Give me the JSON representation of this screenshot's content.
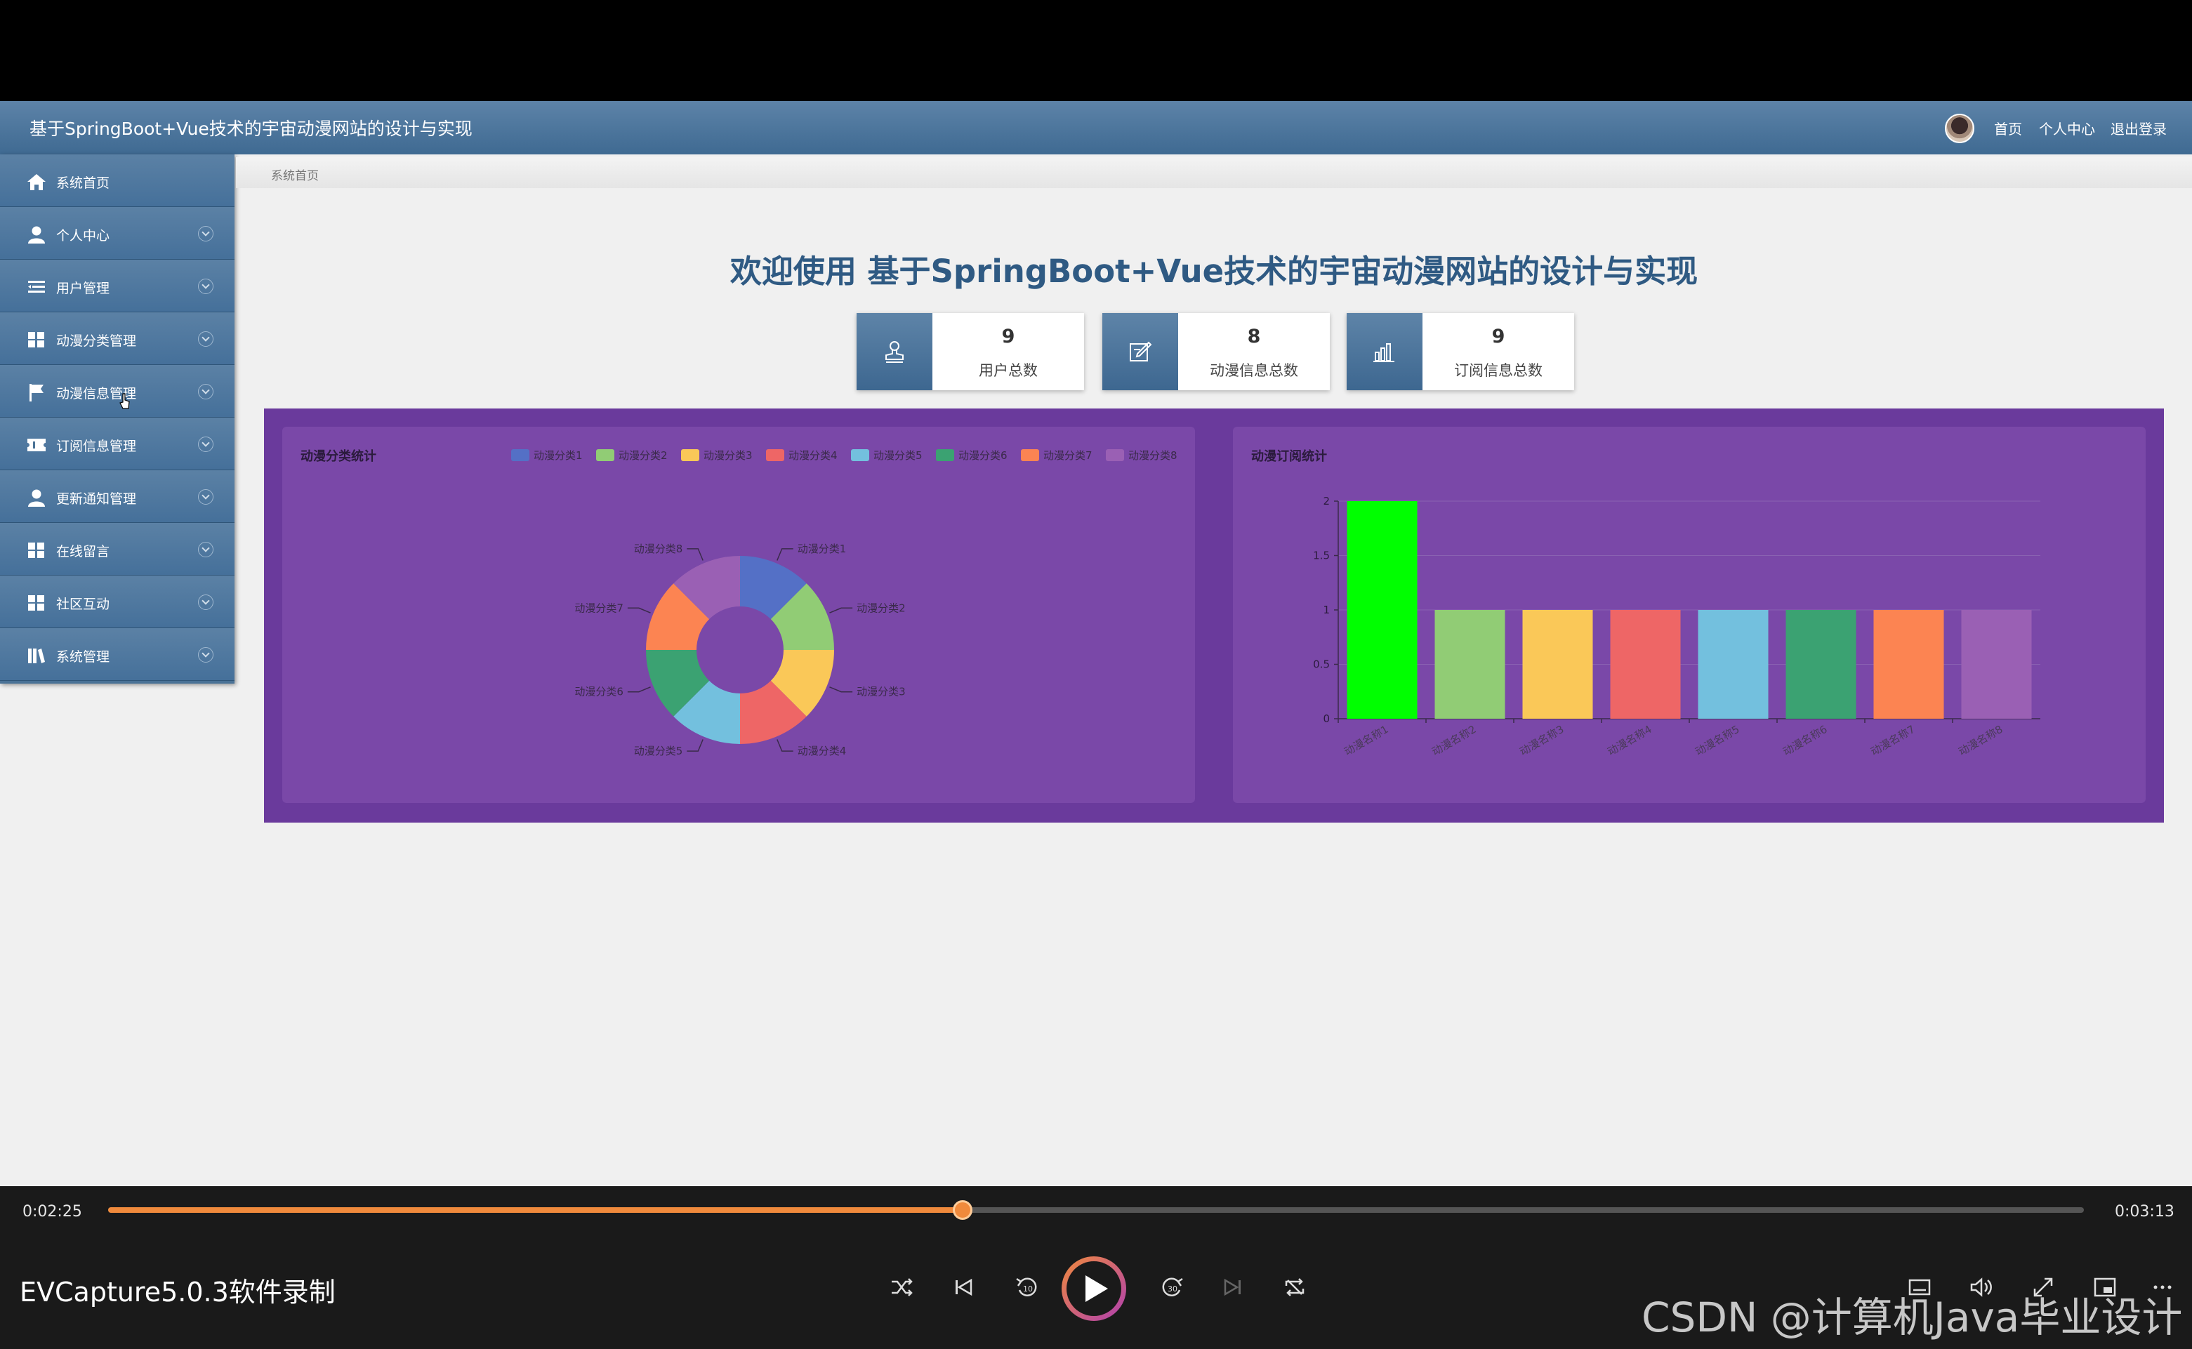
{
  "app": {
    "title": "基于SpringBoot+Vue技术的宇宙动漫网站的设计与实现",
    "nav": [
      "首页",
      "个人中心",
      "退出登录"
    ]
  },
  "sidebar": {
    "items": [
      {
        "label": "系统首页",
        "icon": "home-icon",
        "expandable": false
      },
      {
        "label": "个人中心",
        "icon": "user-icon",
        "expandable": true
      },
      {
        "label": "用户管理",
        "icon": "list-icon",
        "expandable": true
      },
      {
        "label": "动漫分类管理",
        "icon": "grid-icon",
        "expandable": true
      },
      {
        "label": "动漫信息管理",
        "icon": "flag-icon",
        "expandable": true
      },
      {
        "label": "订阅信息管理",
        "icon": "ticket-icon",
        "expandable": true
      },
      {
        "label": "更新通知管理",
        "icon": "user-icon",
        "expandable": true
      },
      {
        "label": "在线留言",
        "icon": "grid-icon",
        "expandable": true
      },
      {
        "label": "社区互动",
        "icon": "grid-icon",
        "expandable": true
      },
      {
        "label": "系统管理",
        "icon": "library-icon",
        "expandable": true
      }
    ]
  },
  "breadcrumb": "系统首页",
  "welcome": "欢迎使用 基于SpringBoot+Vue技术的宇宙动漫网站的设计与实现",
  "stats": [
    {
      "value": "9",
      "label": "用户总数",
      "icon": "stamp-icon"
    },
    {
      "value": "8",
      "label": "动漫信息总数",
      "icon": "edit-icon"
    },
    {
      "value": "9",
      "label": "订阅信息总数",
      "icon": "bar-chart-icon"
    }
  ],
  "colors": {
    "primary": "#3f6a92",
    "panel_bg": "#6a3a9c",
    "card_bg": "#7a48a8",
    "palette": [
      "#5470c6",
      "#91cc75",
      "#fac858",
      "#ee6666",
      "#73c0de",
      "#3ba272",
      "#fc8452",
      "#9a60b4"
    ]
  },
  "chart_data": [
    {
      "type": "pie",
      "title": "动漫分类统计",
      "donut": true,
      "legend_position": "top-right",
      "categories": [
        "动漫分类1",
        "动漫分类2",
        "动漫分类3",
        "动漫分类4",
        "动漫分类5",
        "动漫分类6",
        "动漫分类7",
        "动漫分类8"
      ],
      "values": [
        1,
        1,
        1,
        1,
        1,
        1,
        1,
        1
      ]
    },
    {
      "type": "bar",
      "title": "动漫订阅统计",
      "categories": [
        "动漫名称1",
        "动漫名称2",
        "动漫名称3",
        "动漫名称4",
        "动漫名称5",
        "动漫名称6",
        "动漫名称7",
        "动漫名称8"
      ],
      "values": [
        2,
        1,
        1,
        1,
        1,
        1,
        1,
        1
      ],
      "bar_colors": [
        "#00ff00",
        "#91cc75",
        "#fac858",
        "#ee6666",
        "#73c0de",
        "#3ba272",
        "#fc8452",
        "#9a60b4"
      ],
      "ylim": [
        0,
        2
      ],
      "yticks": [
        "0",
        "0.5",
        "1",
        "1.5",
        "2"
      ],
      "grid": true
    }
  ],
  "player": {
    "current_time": "0:02:25",
    "total_time": "0:03:13",
    "progress": 0.4326,
    "recording_title": "EVCapture5.0.3软件录制",
    "watermark": "CSDN @计算机Java毕业设计"
  }
}
